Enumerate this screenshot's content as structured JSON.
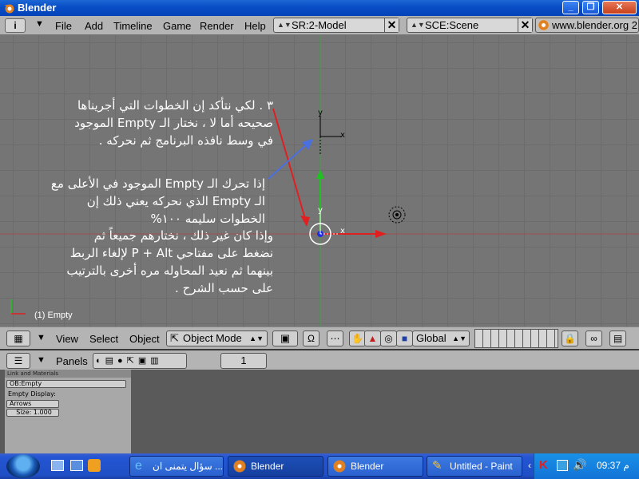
{
  "window": {
    "title": "Blender",
    "controls": [
      "minimize",
      "restore",
      "close"
    ]
  },
  "header": {
    "menus": [
      "File",
      "Add",
      "Timeline",
      "Game",
      "Render",
      "Help"
    ],
    "screen_field": "SR:2-Model",
    "scene_field": "SCE:Scene",
    "site": "www.blender.org 2"
  },
  "viewport": {
    "object_label": "(1) Empty",
    "axis_x": "x",
    "axis_y": "y",
    "para1": [
      "٣ . لكي نتأكد إن الخطوات التي أجريناها",
      "صحيحه أما لا ، نختار الـ Empty الموجود",
      "في وسط نافذه البرنامج ثم نحركه ."
    ],
    "para2": [
      "إذا تحرك الـ Empty الموجود في الأعلى مع",
      "الـ Empty الذي نحركه يعني ذلك إن",
      "الخطوات سليمه ١٠٠%"
    ],
    "para3": [
      "وإذا كان غير ذلك ، نختارهم جميعاً ثم",
      "نضغط على مفتاحي P + Alt لإلغاء الربط",
      "بينهما ثم نعيد المحاوله مره أخرى بالترتيب",
      "على حسب الشرح ."
    ]
  },
  "view_header": {
    "menus": [
      "View",
      "Select",
      "Object"
    ],
    "mode": "Object Mode",
    "orientation": "Global"
  },
  "buttons_window": {
    "panels_label": "Panels",
    "frame": "1",
    "panel_title": "Link and Materials",
    "ob_field": "OB:Empty",
    "display_label": "Empty Display:",
    "display_type": "Arrows",
    "size_field": "Size: 1.000"
  },
  "taskbar": {
    "tasks": [
      {
        "label": "سؤال يتمنى ان ...",
        "icon": "ie-icon"
      },
      {
        "label": "Blender",
        "icon": "blender-icon"
      },
      {
        "label": "Blender",
        "icon": "blender-icon"
      },
      {
        "label": "Untitled - Paint",
        "icon": "paint-icon"
      }
    ],
    "clock": "09:37 م"
  },
  "colors": {
    "viewport_bg": "#757575",
    "header_bg": "#b4b4b4",
    "axis_red": "#e02020",
    "axis_green": "#20c020",
    "taskbar_blue": "#2455d3"
  }
}
